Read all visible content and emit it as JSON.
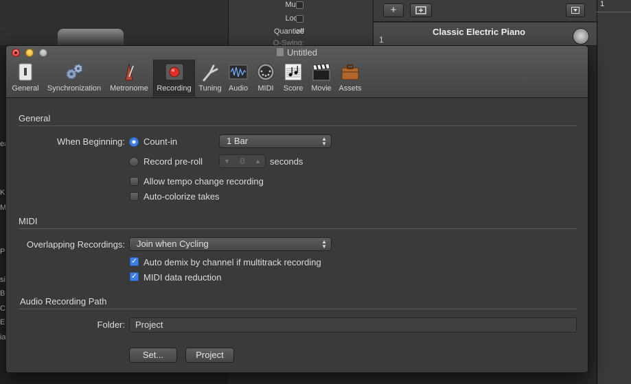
{
  "background_app": {
    "inspector": {
      "mute_label": "Mute:",
      "loop_label": "Loop:",
      "quantize_label": "Quantize",
      "quantize_value": "off",
      "swing_label": "Q-Swing:"
    },
    "track": {
      "number": "1",
      "name": "Classic Electric Piano"
    },
    "ruler_start": "1",
    "add_button_glyph": "+",
    "left_list_fragments": [
      "ea",
      "Ki",
      "Ma",
      "Pr",
      "si",
      "B",
      "C",
      "E",
      "ia"
    ]
  },
  "window": {
    "title": "Untitled",
    "toolbar": [
      {
        "label": "General",
        "icon": "general-switch-icon"
      },
      {
        "label": "Synchronization",
        "icon": "gears-icon"
      },
      {
        "label": "Metronome",
        "icon": "metronome-icon"
      },
      {
        "label": "Recording",
        "icon": "record-icon",
        "selected": true
      },
      {
        "label": "Tuning",
        "icon": "tuning-fork-icon"
      },
      {
        "label": "Audio",
        "icon": "audio-waveform-icon"
      },
      {
        "label": "MIDI",
        "icon": "midi-connector-icon"
      },
      {
        "label": "Score",
        "icon": "score-notes-icon"
      },
      {
        "label": "Movie",
        "icon": "clapperboard-icon"
      },
      {
        "label": "Assets",
        "icon": "briefcase-icon"
      }
    ]
  },
  "general": {
    "title": "General",
    "when_beginning_label": "When Beginning:",
    "count_in_label": "Count-in",
    "count_in_value": "1 Bar",
    "pre_roll_label": "Record pre-roll",
    "pre_roll_value": "0",
    "pre_roll_unit": "seconds",
    "tempo_change_label": "Allow tempo change recording",
    "auto_colorize_label": "Auto-colorize takes"
  },
  "midi": {
    "title": "MIDI",
    "overlapping_label": "Overlapping Recordings:",
    "overlapping_value": "Join when Cycling",
    "auto_demix_label": "Auto demix by channel if multitrack recording",
    "data_reduction_label": "MIDI data reduction"
  },
  "audio_path": {
    "title": "Audio Recording Path",
    "folder_label": "Folder:",
    "folder_value": "Project",
    "set_button": "Set...",
    "project_button": "Project"
  },
  "colors": {
    "accent": "#3d7fe3",
    "record_red": "#e0302a",
    "window_bg": "#3a3a3a"
  }
}
